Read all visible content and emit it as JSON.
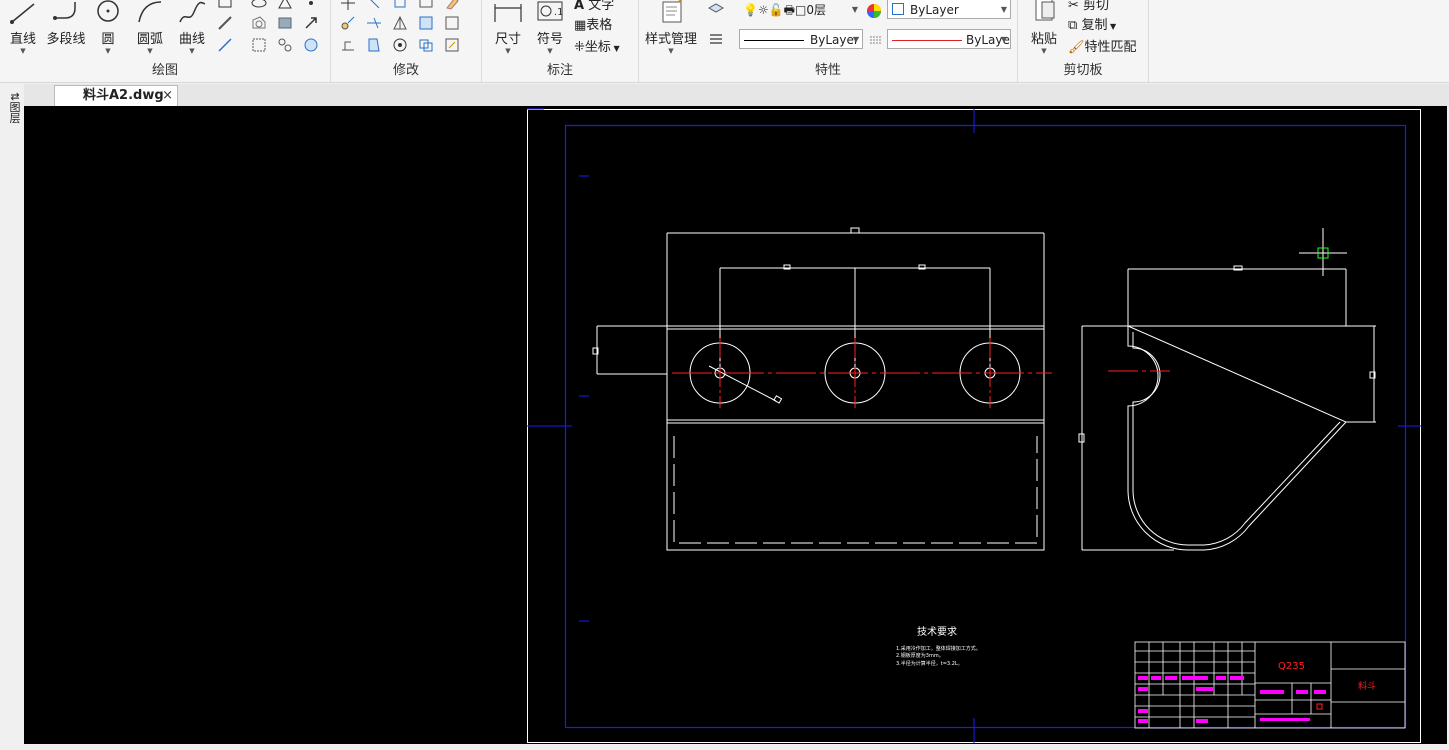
{
  "ribbon": {
    "draw_group": {
      "title": "绘图",
      "line": "直线",
      "polyline": "多段线",
      "circle": "圆",
      "arc": "圆弧",
      "curve": "曲线"
    },
    "modify_group": {
      "title": "修改"
    },
    "annotate_group": {
      "title": "标注",
      "dimension": "尺寸",
      "symbol": "符号",
      "text": "文字",
      "table": "表格",
      "coordinate": "坐标"
    },
    "properties_group": {
      "title": "特性",
      "style_manager": "样式管理",
      "layer_value": "0层",
      "color_value": "ByLayer",
      "linetype_value": "ByLayer",
      "lineweight_value": "ByLaye"
    },
    "clipboard_group": {
      "title": "剪切板",
      "paste": "粘贴",
      "cut": "剪切",
      "copy": "复制",
      "match_properties": "特性匹配"
    }
  },
  "document_tab": {
    "label": "料斗A2.dwg",
    "close": "×"
  },
  "side_panel": {
    "label": "图层"
  },
  "drawing": {
    "tech_title": "技术要求",
    "tech_lines": [
      "1.采用冷作加工，整体焊接加工方式。",
      "2.钢板厚度为3mm。",
      "3.半径为计算半径，t=3.2L。"
    ],
    "material": "Q235",
    "part_name": "料斗"
  },
  "colors": {
    "canvas_bg": "#000000",
    "frame_blue": "#1a1aff",
    "line_white": "#ffffff",
    "center_red": "#ff2020",
    "title_magenta": "#ff00ff",
    "ribbon_bg": "#f5f5f5"
  }
}
